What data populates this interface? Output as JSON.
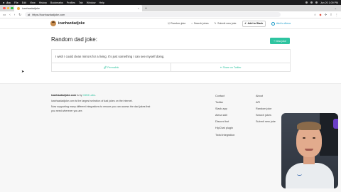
{
  "menubar": {
    "app": "Arc",
    "items": [
      "File",
      "Edit",
      "View",
      "History",
      "Bookmarks",
      "Profiles",
      "Tab",
      "Window",
      "Help"
    ],
    "datetime": "Jun 20 1:09 PM"
  },
  "browser": {
    "tab_title": "icanhazdadjoke",
    "url": "https://icanhazdadjoke.com"
  },
  "site": {
    "logo_text": "icanhazdadjoke",
    "nav": {
      "random": "Random joke",
      "search": "Search jokes",
      "submit": "Submit new joke",
      "slack": "Add to Slack",
      "alexa": "Add to Alexa"
    }
  },
  "main": {
    "heading": "Random dad joke:",
    "new_joke_button": "New joke",
    "joke_text": "I wish I could clean mirrors for a living. It's just something I can see myself doing.",
    "permalink": "Permalink",
    "share": "Share on Twitter"
  },
  "footer": {
    "brand": "icanhazdadjoke.com",
    "by": " is by ",
    "company": "C653 Labs",
    "period": ".",
    "desc1": "icanhazdadjoke.com is the largest selection of dad jokes on the internet.",
    "desc2": "Now supporting many different integrations to ensure you can access the dad jokes that you need wherever you are.",
    "col1": [
      "Contact",
      "Twitter",
      "Slack app",
      "Alexa skill",
      "Discord bot",
      "HipChat plugin",
      "Twist integration"
    ],
    "col2": [
      "About",
      "API",
      "Random joke",
      "Search jokes",
      "Submit new joke"
    ]
  },
  "colors": {
    "accent": "#2ec4a0",
    "alexa": "#1a9bc9"
  }
}
